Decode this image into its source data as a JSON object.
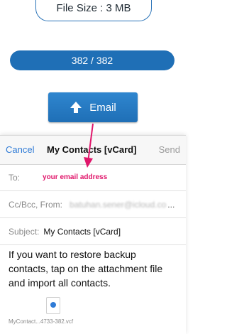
{
  "file_size_label": "File Size : 3 MB",
  "progress": {
    "text": "382 / 382",
    "fraction": 1.0
  },
  "email_button": {
    "label": "Email",
    "icon": "up-arrow-icon"
  },
  "compose": {
    "cancel": "Cancel",
    "title": "My Contacts [vCard]",
    "send": "Send",
    "to_label": "To:",
    "to_hint": "your email address",
    "cc_label": "Cc/Bcc, From:",
    "cc_value": "batuhan.sener@icloud.co",
    "cc_ellipsis": "...",
    "subject_label": "Subject:",
    "subject_value": "My Contacts [vCard]",
    "body": "If you want to restore backup contacts, tap on the attachment file and import all contacts.",
    "attachment_name": "MyContact...4733-382.vcf"
  },
  "colors": {
    "accent": "#1f6fb6",
    "link": "#2f7bd6",
    "hint": "#e0156a"
  }
}
